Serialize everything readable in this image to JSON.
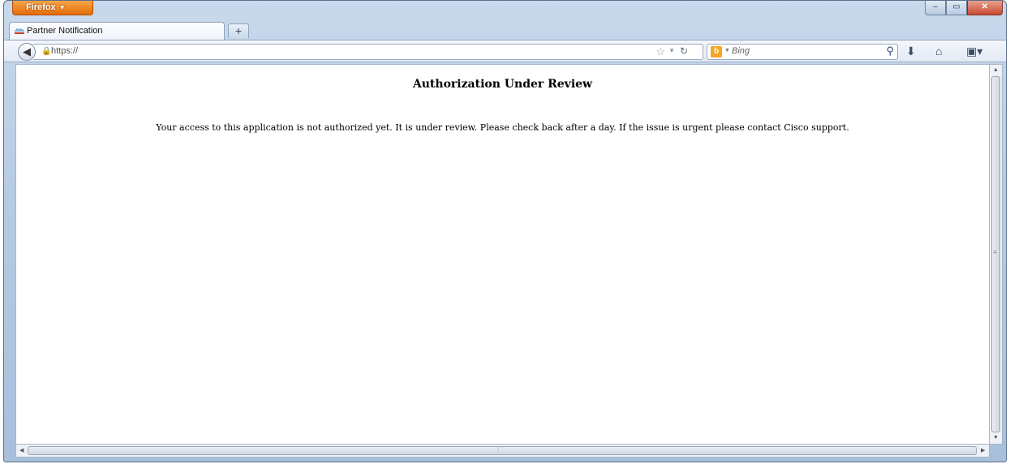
{
  "browser": {
    "menu_label": "Firefox",
    "menu_icon": "chevron-down-icon",
    "caption": {
      "minimize": "minimize-icon",
      "maximize": "maximize-icon",
      "close": "close-icon"
    }
  },
  "tabs": [
    {
      "label": "Partner Notification",
      "favicon": "cisco-logo-icon"
    }
  ],
  "new_tab_label": "+",
  "address": {
    "url": "https://",
    "lock_icon": "lock-icon",
    "bookmark_icon": "star-icon",
    "reload_icon": "reload-icon"
  },
  "search": {
    "engine_icon": "bing-icon",
    "placeholder": "Bing",
    "icon": "search-icon"
  },
  "toolbar_icons": [
    "download-icon",
    "home-icon",
    "bookmarks-menu-icon"
  ],
  "page": {
    "title": "Authorization Under Review",
    "message": "Your access to this application is not authorized yet. It is under review. Please check back after a day. If the issue is urgent please contact Cisco support."
  },
  "colors": {
    "firefox_button": "#e46c08",
    "close_button": "#c74a31",
    "bing": "#f5a623"
  }
}
